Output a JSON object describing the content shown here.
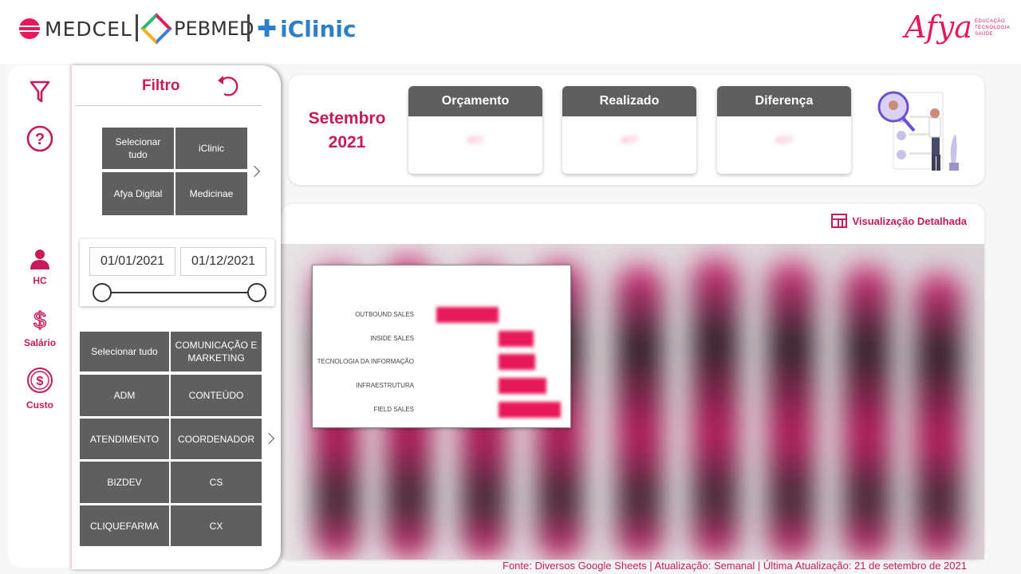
{
  "header": {
    "medcel": "MEDCEL",
    "pebmed": "PEBMED",
    "iclinic": "iClinic",
    "afya": "Afya",
    "afya_tagline": [
      "EDUCAÇÃO",
      "TECNOLOGIA",
      "SAÚDE"
    ]
  },
  "sidebar": {
    "items": [
      {
        "label": "",
        "icon": "filter-icon"
      },
      {
        "label": "",
        "icon": "help-icon"
      },
      {
        "label": "HC",
        "icon": "person-icon"
      },
      {
        "label": "Salário",
        "icon": "dollar-icon"
      },
      {
        "label": "Custo",
        "icon": "coin-icon"
      }
    ]
  },
  "filter": {
    "title": "Filtro",
    "company_tiles": [
      "Selecionar tudo",
      "iClinic",
      "Afya Digital",
      "Medicinae"
    ],
    "date_start": "01/01/2021",
    "date_end": "01/12/2021",
    "area_tiles": [
      "Selecionar tudo",
      "COMUNICAÇÃO E MARKETING",
      "ADM",
      "CONTEÚDO",
      "ATENDIMENTO",
      "COORDENADOR",
      "BIZDEV",
      "CS",
      "CLIQUEFARMA",
      "CX"
    ]
  },
  "summary": {
    "month": "Setembro",
    "year": "2021",
    "kpis": [
      {
        "title": "Orçamento",
        "value": "407"
      },
      {
        "title": "Realizado",
        "value": "407"
      },
      {
        "title": "Diferença",
        "value": "407"
      }
    ]
  },
  "detail_link": "Visualização Detalhada",
  "tooltip": {
    "rows": [
      "OUTBOUND SALES",
      "INSIDE SALES",
      "TECNOLOGIA DA INFORMAÇÃO",
      "INFRAESTRUTURA",
      "FIELD SALES"
    ]
  },
  "footer": "Fonte: Diversos Google Sheets | Atualização: Semanal | Última Atualização: 21 de setembro de 2021",
  "colors": {
    "accent": "#c8195a",
    "tile": "#5f5f5f",
    "brand_blue": "#2d7fc8"
  }
}
